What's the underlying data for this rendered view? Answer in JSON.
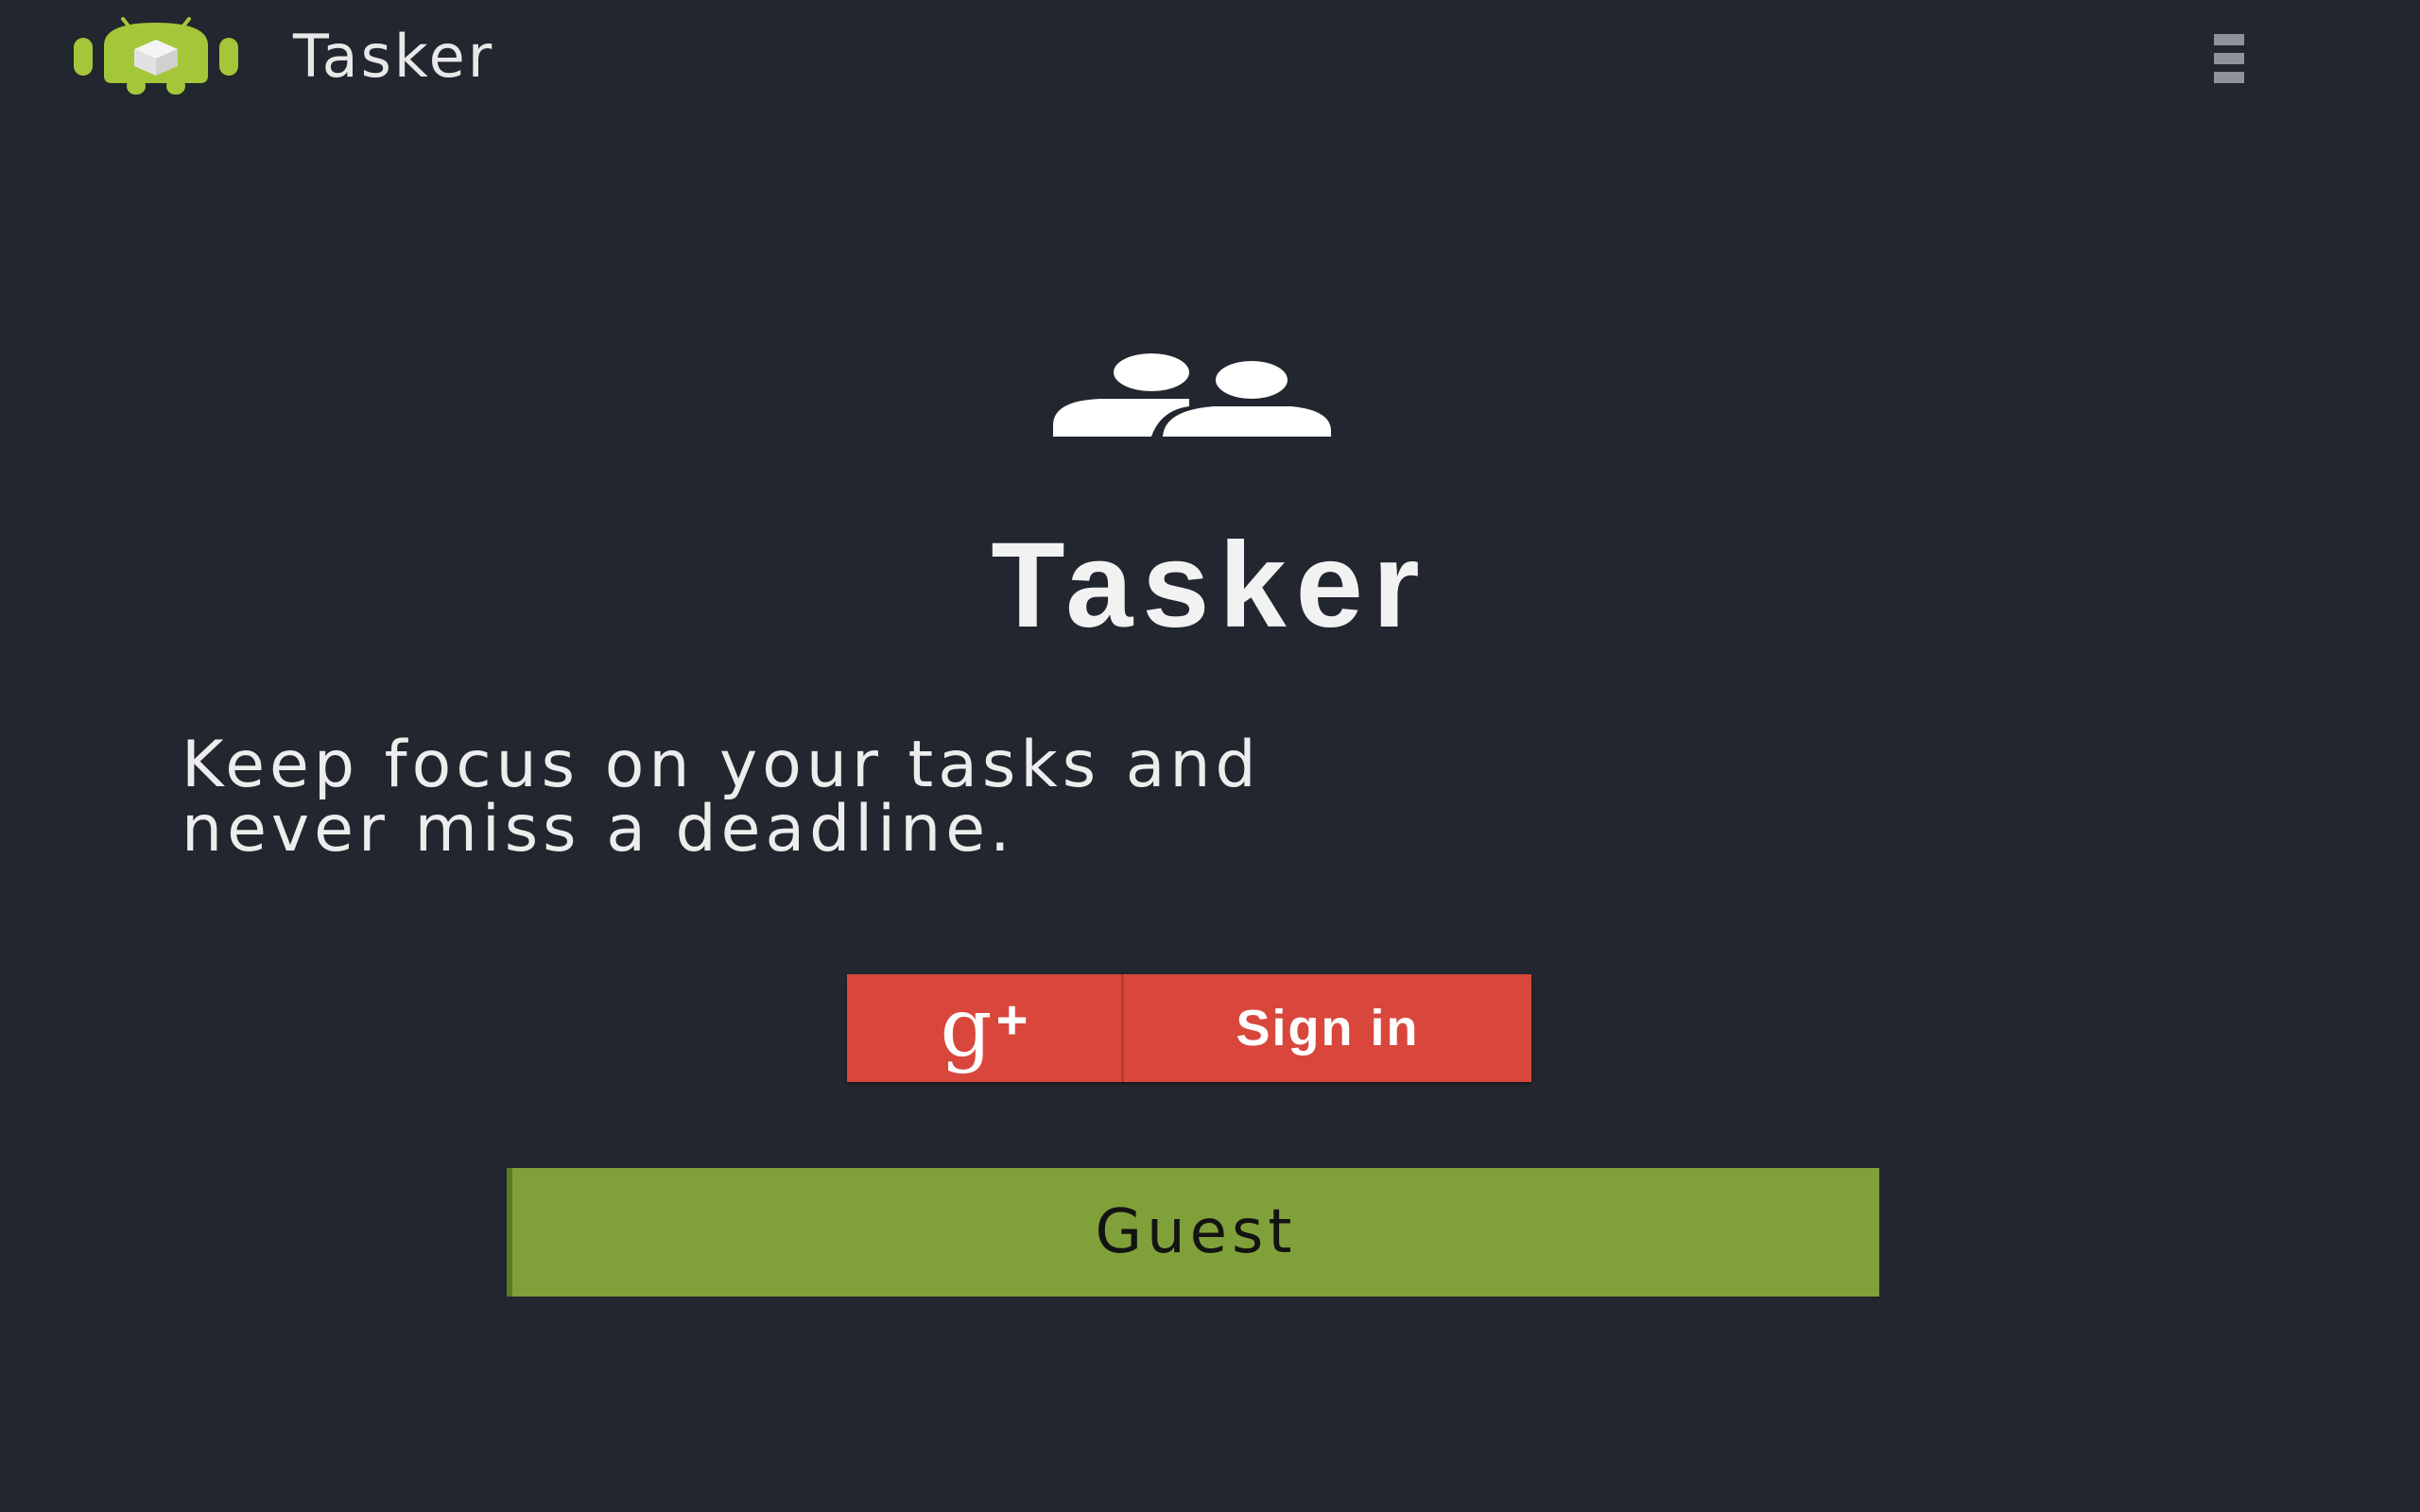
{
  "action_bar": {
    "title": "Tasker",
    "icon": "android-robot-icon",
    "menu_icon": "overflow-menu-icon"
  },
  "main": {
    "hero_icon": "people-icon",
    "title": "Tasker",
    "tagline_line1": "Keep focus on your tasks and",
    "tagline_line2": "never miss a deadline.",
    "google_button": {
      "logo": "g+",
      "label": "Sign in"
    },
    "guest_button": {
      "label": "Guest"
    }
  },
  "colors": {
    "background": "#22262e",
    "google_red": "#d9473c",
    "guest_green": "#80a03a",
    "android_green": "#a4c639"
  }
}
